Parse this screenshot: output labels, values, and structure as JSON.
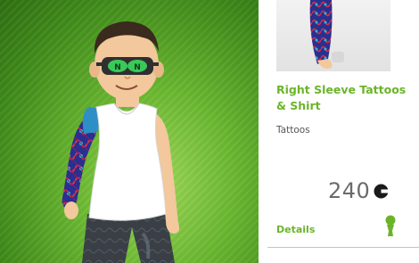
{
  "item": {
    "title": "Right Sleeve Tattoos & Shirt",
    "category": "Tattoos",
    "price": "240",
    "details_label": "Details"
  },
  "icons": {
    "points": "microsoft-points-icon",
    "avatar": "avatar-silhouette-icon"
  },
  "colors": {
    "accent": "#6bb42a",
    "price_text": "#6a6a6a",
    "stage_green": "#6cba32"
  }
}
